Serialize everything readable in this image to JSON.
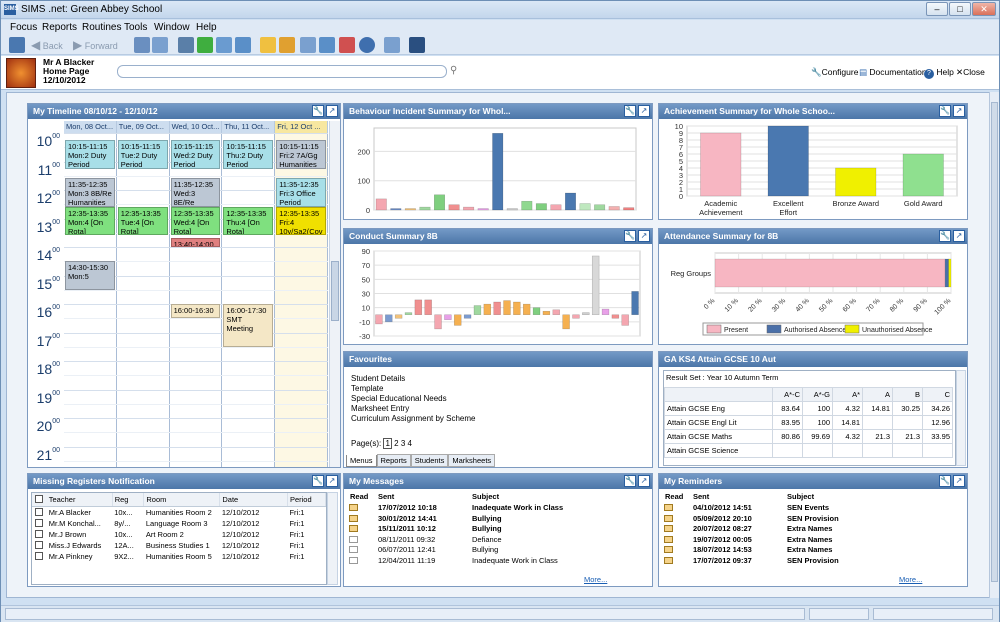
{
  "app": {
    "title": "SIMS .net: Green Abbey School",
    "icon_label": "SIMS"
  },
  "menu": [
    "Focus",
    "Reports",
    "Routines",
    "Tools",
    "Window",
    "Help"
  ],
  "toolbar": {
    "back_label": "Back",
    "forward_label": "Forward"
  },
  "header": {
    "user_name": "Mr A Blacker",
    "page_name": "Home Page",
    "date": "12/10/2012",
    "search_placeholder": "",
    "links": {
      "configure": "Configure",
      "documentation": "Documentation",
      "help": "Help",
      "close": "Close"
    }
  },
  "timeline": {
    "title": "My Timeline 08/10/12 - 12/10/12",
    "days": [
      "Mon, 08 Oct...",
      "Tue, 09 Oct...",
      "Wed, 10 Oct...",
      "Thu, 11 Oct...",
      "Fri, 12 Oct ..."
    ],
    "hours": [
      "10",
      "11",
      "12",
      "13",
      "14",
      "15",
      "16",
      "17",
      "18",
      "19",
      "20",
      "21"
    ],
    "hour_suffix": "00",
    "events": [
      {
        "day": 0,
        "start": 10.25,
        "end": 11.25,
        "text": "10:15-11:15 Mon:2 Duty Period",
        "color": "#a8dfe8"
      },
      {
        "day": 1,
        "start": 10.25,
        "end": 11.25,
        "text": "10:15-11:15 Tue:2 Duty Period",
        "color": "#a8dfe8"
      },
      {
        "day": 2,
        "start": 10.25,
        "end": 11.25,
        "text": "10:15-11:15 Wed:2 Duty Period",
        "color": "#a8dfe8"
      },
      {
        "day": 3,
        "start": 10.25,
        "end": 11.25,
        "text": "10:15-11:15 Thu:2 Duty Period",
        "color": "#a8dfe8"
      },
      {
        "day": 4,
        "start": 10.25,
        "end": 11.25,
        "text": "10:15-11:15 Fri:2 7A/Gg Humanities",
        "color": "#bcc7d4"
      },
      {
        "day": 0,
        "start": 11.583,
        "end": 12.583,
        "text": "11:35-12:35 Mon:3 8B/Re Humanities",
        "color": "#bcc7d4"
      },
      {
        "day": 2,
        "start": 11.583,
        "end": 12.583,
        "text": "11:35-12:35 Wed:3 8E/Re Humanities",
        "color": "#bcc7d4"
      },
      {
        "day": 4,
        "start": 11.583,
        "end": 12.583,
        "text": "11:35-12:35 Fri:3 Office Period",
        "color": "#a8dfe8"
      },
      {
        "day": 0,
        "start": 12.583,
        "end": 13.583,
        "text": "12:35-13:35 Mon:4 [On Rota]",
        "color": "#7fe07f"
      },
      {
        "day": 1,
        "start": 12.583,
        "end": 13.583,
        "text": "12:35-13:35 Tue:4 [On Rota]",
        "color": "#7fe07f"
      },
      {
        "day": 2,
        "start": 12.583,
        "end": 13.583,
        "text": "12:35-13:35 Wed:4 [On Rota]",
        "color": "#7fe07f"
      },
      {
        "day": 3,
        "start": 12.583,
        "end": 13.583,
        "text": "12:35-13:35 Thu:4 [On Rota]",
        "color": "#7fe07f"
      },
      {
        "day": 4,
        "start": 12.583,
        "end": 13.583,
        "text": "12:35-13:35 Fri:4 10y/Sa2(Cov",
        "color": "#f0e000"
      },
      {
        "day": 2,
        "start": 13.667,
        "end": 14.0,
        "text": "13:40-14:00",
        "color": "#e08080"
      },
      {
        "day": 0,
        "start": 14.5,
        "end": 15.5,
        "text": "14:30-15:30 Mon:5",
        "color": "#bcc7d4"
      },
      {
        "day": 2,
        "start": 16.0,
        "end": 16.5,
        "text": "16:00-16:30",
        "color": "#f4e7c6"
      },
      {
        "day": 3,
        "start": 16.0,
        "end": 17.5,
        "text": "16:00-17:30 SMT Meeting",
        "color": "#f4e7c6"
      }
    ]
  },
  "behaviour": {
    "title": "Behaviour Incident Summary for Whol...",
    "chart_data": {
      "type": "bar",
      "values": [
        38,
        5,
        5,
        10,
        52,
        18,
        10,
        5,
        262,
        5,
        30,
        22,
        18,
        58,
        22,
        18,
        12,
        8
      ],
      "colors": [
        "#f4a6b0",
        "#6b8cc7",
        "#f2c27a",
        "#9fd89f",
        "#7fcf7f",
        "#f08f8f",
        "#f4a6b0",
        "#e8a0e8",
        "#4a78b0",
        "#cfcfcf",
        "#8fd88f",
        "#7fcf7f",
        "#f4a6b0",
        "#4a78b0",
        "#bfe8bf",
        "#9fd89f",
        "#f4b0b0",
        "#f08080"
      ],
      "ylim": [
        0,
        280
      ],
      "yticks": [
        0,
        100,
        200
      ]
    }
  },
  "achievement": {
    "title": "Achievement Summary for Whole Schoo...",
    "chart_data": {
      "type": "bar",
      "categories": [
        "Academic Achievement",
        "Excellent Effort",
        "Bronze Award",
        "Gold Award"
      ],
      "values": [
        9,
        10,
        4,
        6
      ],
      "colors": [
        "#f7b6c2",
        "#4a78b0",
        "#f0f000",
        "#8fe08f"
      ],
      "ylim": [
        0,
        10
      ],
      "yticks": [
        0,
        1,
        2,
        3,
        4,
        5,
        6,
        7,
        8,
        9,
        10
      ]
    }
  },
  "conduct": {
    "title": "Conduct Summary 8B",
    "chart_data": {
      "type": "bar",
      "values": [
        -13,
        -10,
        -5,
        3,
        21,
        21,
        -20,
        -7,
        -15,
        -5,
        13,
        15,
        18,
        20,
        18,
        15,
        10,
        5,
        7,
        -20,
        -5,
        3,
        83,
        8,
        -5,
        -15,
        33
      ],
      "colors": [
        "#f4a6b0",
        "#7b9bd0",
        "#f2c27a",
        "#9fd89f",
        "#f08f8f",
        "#f08f8f",
        "#f4a6b0",
        "#e8a0e8",
        "#f5b050",
        "#7b9bd0",
        "#9fd89f",
        "#f5b050",
        "#f08f8f",
        "#f5b050",
        "#f5b050",
        "#f5b050",
        "#7fcf7f",
        "#f5b050",
        "#f4a6b0",
        "#f5b050",
        "#f4a6b0",
        "#cfcfcf",
        "#d8d8d8",
        "#e8a0e8",
        "#f08f8f",
        "#f4a6b0",
        "#4a78b0"
      ],
      "ylim": [
        -30,
        90
      ],
      "yticks": [
        -30,
        -10,
        10,
        30,
        50,
        70,
        90
      ]
    }
  },
  "attendance": {
    "title": "Attendance Summary for 8B",
    "chart_data": {
      "type": "bar",
      "categories": [
        "Reg Groups"
      ],
      "series": [
        {
          "name": "Present",
          "value": 97.5,
          "color": "#f7b6c2"
        },
        {
          "name": "Authorised Absence",
          "value": 1.5,
          "color": "#4a6fa8"
        },
        {
          "name": "Unauthorised Absence",
          "value": 1.0,
          "color": "#f0f000"
        }
      ],
      "xticks": [
        "0 %",
        "10 %",
        "20 %",
        "30 %",
        "40 %",
        "50 %",
        "60 %",
        "70 %",
        "80 %",
        "90 %",
        "100 %"
      ]
    }
  },
  "favourites": {
    "title": "Favourites",
    "items": [
      "Student Details",
      "Template",
      "Special Educational Needs",
      "Marksheet Entry",
      "Curriculum Assignment by Scheme"
    ],
    "pages_label": "Page(s):",
    "pages": [
      "1",
      "2",
      "3",
      "4"
    ],
    "tabs": [
      "Menus",
      "Reports",
      "Students",
      "Marksheets"
    ]
  },
  "ks4": {
    "title": "GA KS4 Attain GCSE 10 Aut",
    "result_set": "Result Set : Year 10 Autumn Term",
    "columns": [
      "A*-C",
      "A*-G",
      "A*",
      "A",
      "B",
      "C"
    ],
    "rows": [
      {
        "label": "Attain GCSE  Eng",
        "values": [
          "83.64",
          "100",
          "4.32",
          "14.81",
          "30.25",
          "34.26"
        ]
      },
      {
        "label": "Attain GCSE  Engl Lit",
        "values": [
          "",
          "",
          "",
          "",
          "",
          ""
        ]
      },
      {
        "label": "Attain GCSE  Maths",
        "values": [
          "80.86",
          "99.69",
          "4.32",
          "21.3",
          "21.3",
          "33.95"
        ]
      },
      {
        "label": "Attain GCSE  Science",
        "values": [
          "",
          "",
          "",
          "",
          "",
          ""
        ]
      }
    ],
    "engl_lit": [
      "",
      "100",
      "14.81",
      "",
      "",
      "12.96"
    ],
    "engl_lit_first": "83.95"
  },
  "registers": {
    "title": "Missing Registers Notification",
    "columns": [
      "Teacher",
      "Reg",
      "Room",
      "Date",
      "Period"
    ],
    "rows": [
      {
        "teacher": "Mr.A Blacker",
        "reg": "10x...",
        "room": "Humanities Room 2",
        "date": "12/10/2012",
        "period": "Fri:1"
      },
      {
        "teacher": "Mr.M Konchal...",
        "reg": "8y/...",
        "room": "Language Room 3",
        "date": "12/10/2012",
        "period": "Fri:1"
      },
      {
        "teacher": "Mr.J Brown",
        "reg": "10x...",
        "room": "Art Room 2",
        "date": "12/10/2012",
        "period": "Fri:1"
      },
      {
        "teacher": "Miss.J Edwards",
        "reg": "12A...",
        "room": "Business Studies 1",
        "date": "12/10/2012",
        "period": "Fri:1"
      },
      {
        "teacher": "Mr.A Pinkney",
        "reg": "9X2...",
        "room": "Humanities Room 5",
        "date": "12/10/2012",
        "period": "Fri:1"
      }
    ]
  },
  "messages": {
    "title": "My Messages",
    "columns": [
      "Read",
      "Sent",
      "Subject"
    ],
    "rows": [
      {
        "unread": true,
        "sent": "17/07/2012 10:18",
        "subject": "Inadequate Work in Class"
      },
      {
        "unread": true,
        "sent": "30/01/2012 14:41",
        "subject": "Bullying"
      },
      {
        "unread": true,
        "sent": "15/11/2011 10:12",
        "subject": "Bullying"
      },
      {
        "unread": false,
        "sent": "08/11/2011 09:32",
        "subject": "Defiance"
      },
      {
        "unread": false,
        "sent": "06/07/2011 12:41",
        "subject": "Bullying"
      },
      {
        "unread": false,
        "sent": "12/04/2011 11:19",
        "subject": "Inadequate Work in Class"
      }
    ],
    "more": "More..."
  },
  "reminders": {
    "title": "My Reminders",
    "columns": [
      "Read",
      "Sent",
      "Subject"
    ],
    "rows": [
      {
        "sent": "04/10/2012 14:51",
        "subject": "SEN Events"
      },
      {
        "sent": "05/09/2012 20:10",
        "subject": "SEN Provision"
      },
      {
        "sent": "20/07/2012 08:27",
        "subject": "Extra Names"
      },
      {
        "sent": "19/07/2012 00:05",
        "subject": "Extra Names"
      },
      {
        "sent": "18/07/2012 14:53",
        "subject": "Extra Names"
      },
      {
        "sent": "17/07/2012 09:37",
        "subject": "SEN Provision"
      }
    ],
    "more": "More..."
  }
}
